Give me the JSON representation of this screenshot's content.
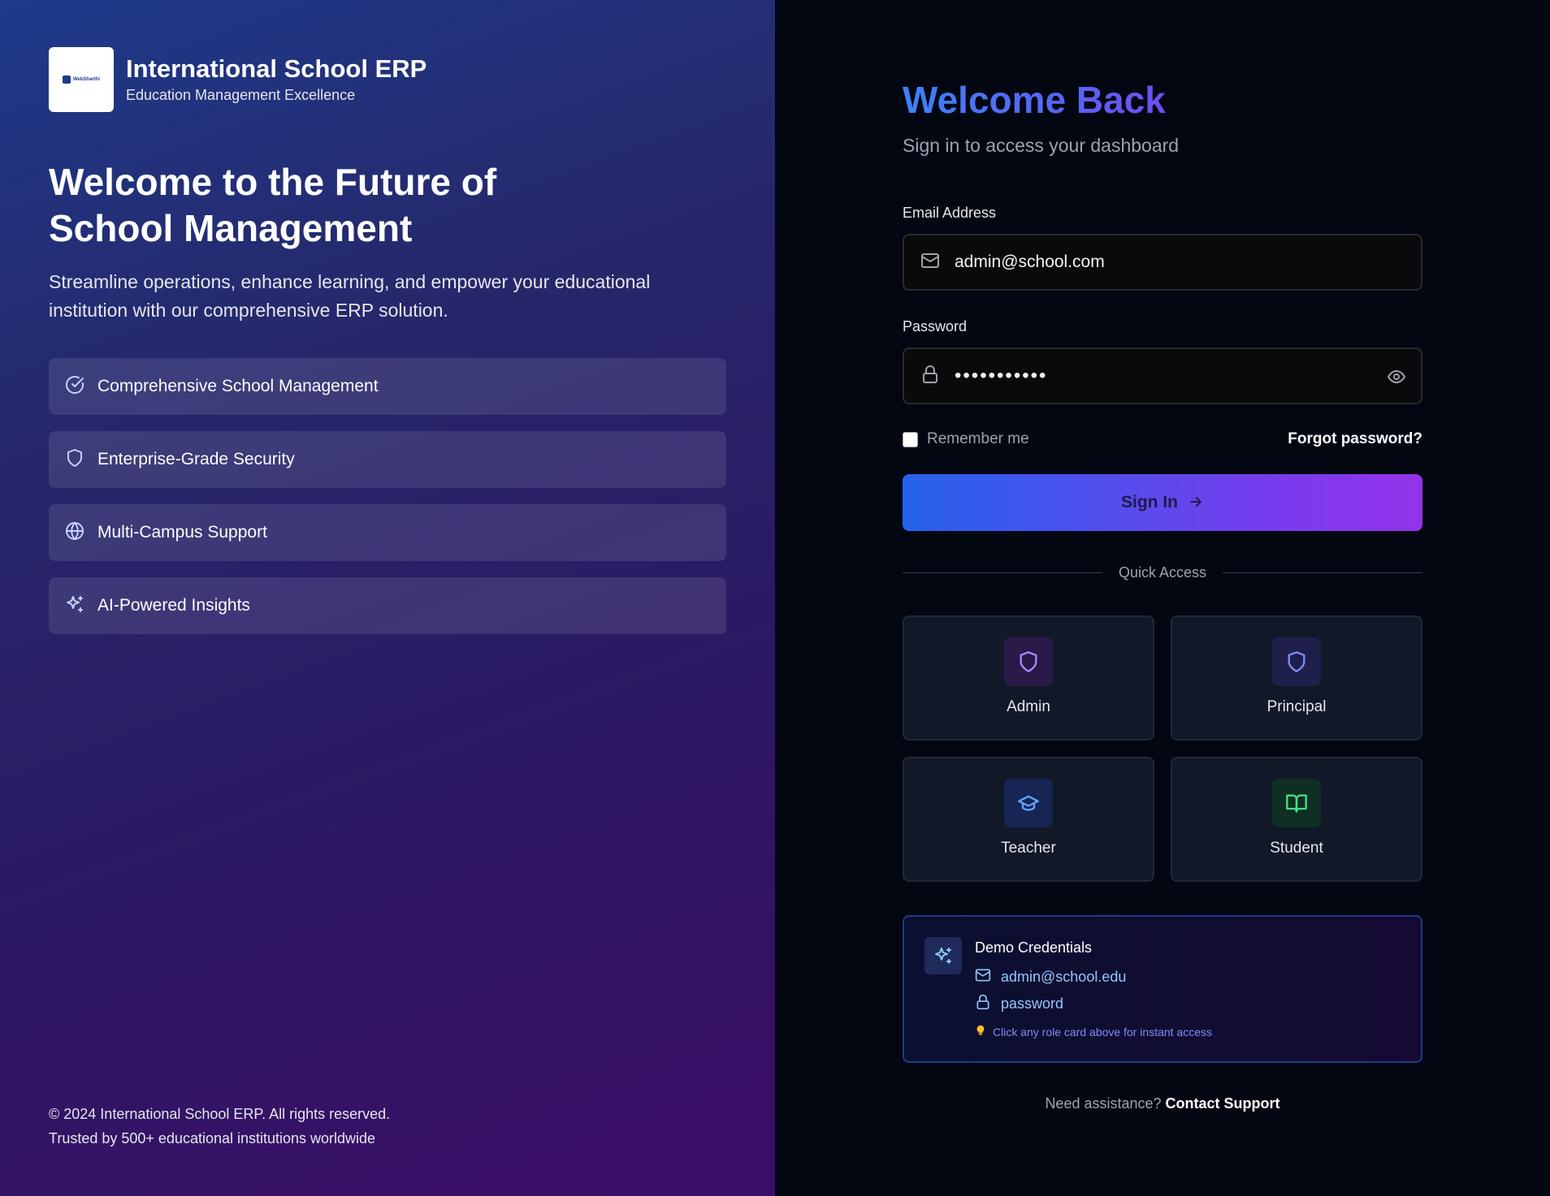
{
  "brand": {
    "title": "International School ERP",
    "subtitle": "Education Management Excellence",
    "logo_text": "WebSharthi"
  },
  "hero": {
    "title_line1": "Welcome to the Future of",
    "title_line2": "School Management",
    "description": "Streamline operations, enhance learning, and empower your educational institution with our comprehensive ERP solution."
  },
  "features": [
    {
      "label": "Comprehensive School Management",
      "icon": "check-circle-icon"
    },
    {
      "label": "Enterprise-Grade Security",
      "icon": "shield-icon"
    },
    {
      "label": "Multi-Campus Support",
      "icon": "globe-icon"
    },
    {
      "label": "AI-Powered Insights",
      "icon": "sparkles-icon"
    }
  ],
  "footer": {
    "copyright": "© 2024 International School ERP. All rights reserved.",
    "tagline": "Trusted by 500+ educational institutions worldwide"
  },
  "login": {
    "title": "Welcome Back",
    "subtitle": "Sign in to access your dashboard",
    "email_label": "Email Address",
    "email_value": "admin@school.com",
    "password_label": "Password",
    "password_masked": "•••••••••••",
    "remember_label": "Remember me",
    "forgot_label": "Forgot password?",
    "signin_label": "Sign In"
  },
  "quick_access": {
    "label": "Quick Access",
    "roles": [
      {
        "label": "Admin",
        "icon": "shield-icon",
        "color": "#a78bfa",
        "bg": "#2a1a4a"
      },
      {
        "label": "Principal",
        "icon": "shield-icon",
        "color": "#818cf8",
        "bg": "#1e1f4a"
      },
      {
        "label": "Teacher",
        "icon": "graduation-cap-icon",
        "color": "#60a5fa",
        "bg": "#172554"
      },
      {
        "label": "Student",
        "icon": "book-open-icon",
        "color": "#4ade80",
        "bg": "#0f2e24"
      }
    ]
  },
  "demo": {
    "title": "Demo Credentials",
    "email": "admin@school.edu",
    "password": "password",
    "hint": "Click any role card above for instant access"
  },
  "support": {
    "prompt": "Need assistance?",
    "link": "Contact Support"
  },
  "colors": {
    "accent_blue": "#2563eb",
    "accent_purple": "#9333ea",
    "background": "#030712"
  }
}
